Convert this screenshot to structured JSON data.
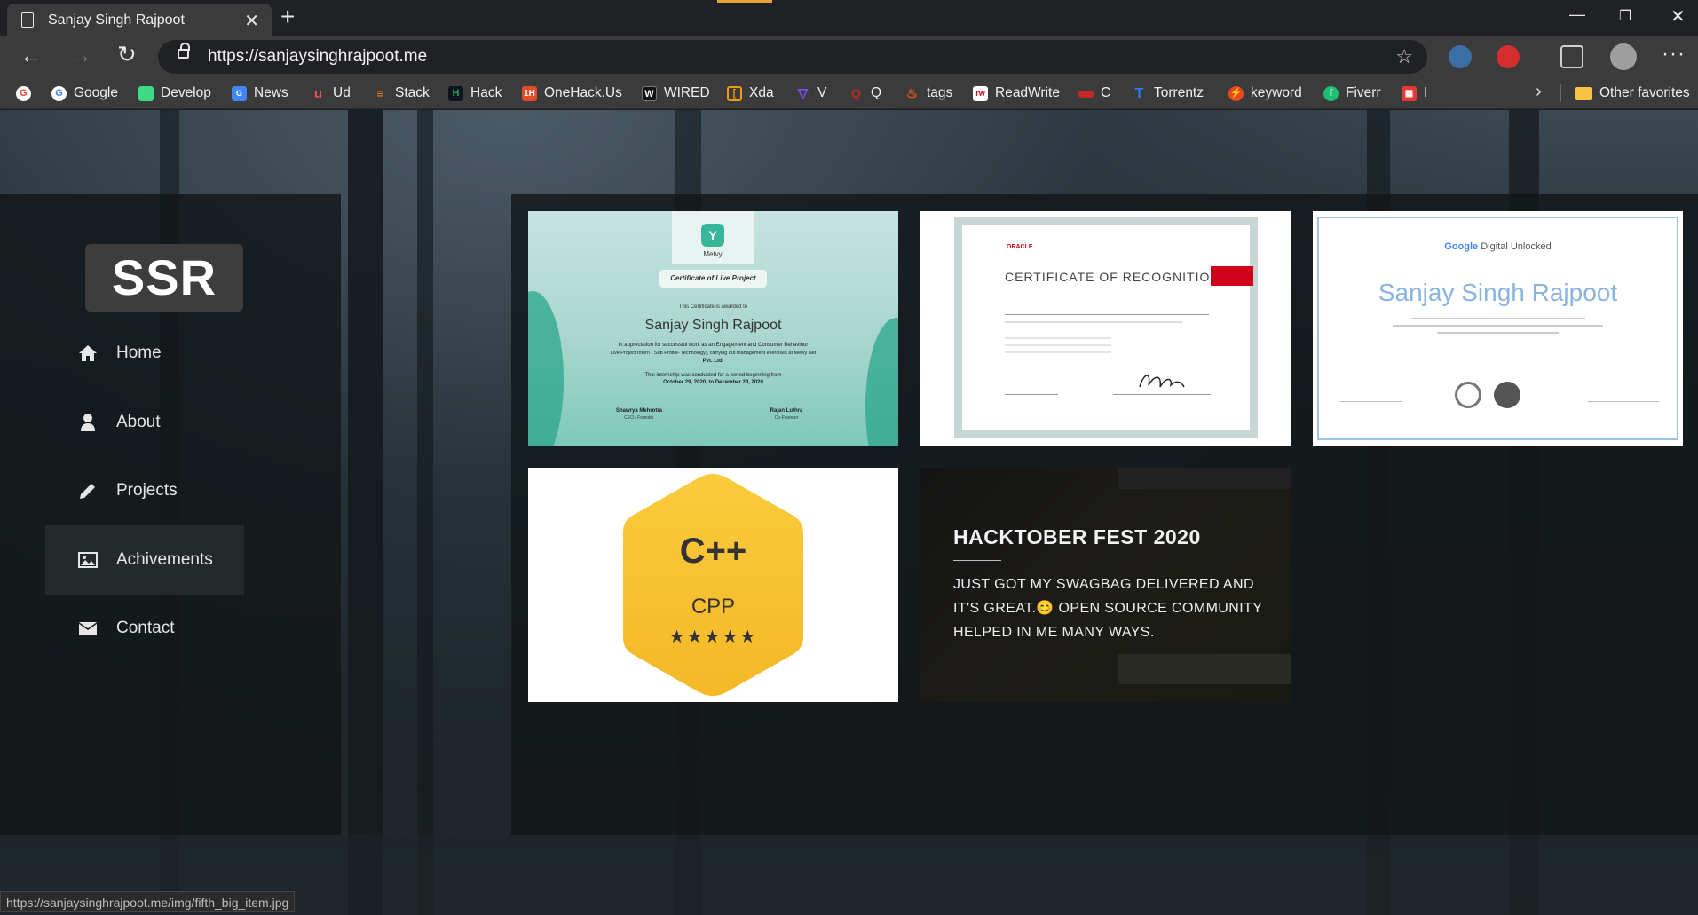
{
  "browser": {
    "tab_title": "Sanjay Singh Rajpoot",
    "url": "https://sanjaysinghrajpoot.me",
    "bookmarks": [
      {
        "label": "",
        "icon": "google-icon",
        "color": "#ea4335"
      },
      {
        "label": "Google",
        "icon": "google-icon",
        "color": "#4285f4"
      },
      {
        "label": "Develop",
        "icon": "car-icon",
        "color": "#3ddc84"
      },
      {
        "label": "News",
        "icon": "google-news-icon",
        "color": "#4285f4"
      },
      {
        "label": "Ud",
        "icon": "udemy-icon",
        "color": "#ec5252"
      },
      {
        "label": "Stack",
        "icon": "stackoverflow-icon",
        "color": "#f48024"
      },
      {
        "label": "Hack",
        "icon": "hackerrank-icon",
        "color": "#1ba94c"
      },
      {
        "label": "OneHack.Us",
        "icon": "onehack-icon",
        "color": "#e34c26"
      },
      {
        "label": "WIRED",
        "icon": "wired-icon",
        "color": "#000000"
      },
      {
        "label": "Xda",
        "icon": "xda-icon",
        "color": "#f59714"
      },
      {
        "label": "V",
        "icon": "vue-icon",
        "color": "#8a4bff"
      },
      {
        "label": "Q",
        "icon": "quora-icon",
        "color": "#b92b27"
      },
      {
        "label": "tags",
        "icon": "fire-icon",
        "color": "#e6501e"
      },
      {
        "label": "ReadWrite",
        "icon": "readwrite-icon",
        "color": "#d0021b"
      },
      {
        "label": "C",
        "icon": "c-icon",
        "color": "#c62828"
      },
      {
        "label": "Torrentz",
        "icon": "torrentz-icon",
        "color": "#2979ff"
      },
      {
        "label": "keyword",
        "icon": "keyword-icon",
        "color": "#e64a19"
      },
      {
        "label": "Fiverr",
        "icon": "fiverr-icon",
        "color": "#1dbf73"
      },
      {
        "label": "I",
        "icon": "grid-app-icon",
        "color": "#e53935"
      }
    ],
    "other_favorites": "Other favorites",
    "status_url": "https://sanjaysinghrajpoot.me/img/fifth_big_item.jpg"
  },
  "site": {
    "logo": "SSR",
    "nav": [
      {
        "label": "Home",
        "icon": "home-icon"
      },
      {
        "label": "About",
        "icon": "user-icon"
      },
      {
        "label": "Projects",
        "icon": "pencil-icon"
      },
      {
        "label": "Achivements",
        "icon": "image-icon",
        "active": true
      },
      {
        "label": "Contact",
        "icon": "envelope-icon"
      }
    ],
    "cards": {
      "metvy": {
        "brand": "Metvy",
        "heading": "Certificate of Live Project",
        "awarded": "This Certificate is awarded to",
        "name": "Sanjay Singh Rajpoot",
        "line1": "In appreciation for successful work as an Engagement and Consumer Behaviour",
        "line2": "Live Project Intern ( Sub Profile- Technology), carrying out management exercises at Metvy Net",
        "line3": "Pvt. Ltd.",
        "period": "This internship was conducted for a period beginning from",
        "dates": "October 29, 2020, to December 29, 2020",
        "sig1_name": "Shawrya Mehrotra",
        "sig1_role": "CEO / Founder",
        "sig2_name": "Rajan Luthra",
        "sig2_role": "Co-Founder"
      },
      "oracle": {
        "brand": "ORACLE",
        "title": "CERTIFICATE OF RECOGNITION"
      },
      "google": {
        "brand": "Google",
        "sub": "Digital Unlocked",
        "name": "Sanjay Singh Rajpoot"
      },
      "cpp": {
        "symbol": "C++",
        "label": "CPP",
        "stars": "★★★★★"
      },
      "hacktober": {
        "title": "HACKTOBER FEST 2020",
        "body": "JUST GOT MY SWAGBAG DELIVERED AND IT'S GREAT.😊 OPEN SOURCE COMMUNITY HELPED IN ME MANY WAYS."
      }
    }
  }
}
